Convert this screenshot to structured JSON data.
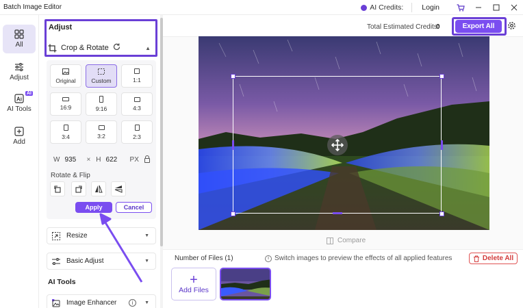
{
  "app": {
    "title": "Batch Image Editor"
  },
  "titlebar": {
    "ai_credits_label": "AI Credits:",
    "login_label": "Login",
    "icons": [
      "credit-icon",
      "cart-icon",
      "maximize-icon",
      "minimize-icon",
      "restore-icon",
      "close-icon"
    ]
  },
  "leftnav": {
    "items": [
      {
        "label": "All",
        "icon": "grid-icon",
        "active": true
      },
      {
        "label": "Adjust",
        "icon": "sliders-icon"
      },
      {
        "label": "AI Tools",
        "icon": "ai-icon",
        "badge": "AI"
      },
      {
        "label": "Add",
        "icon": "plus-square-icon"
      }
    ]
  },
  "adjust_panel": {
    "title": "Adjust",
    "crop_rotate_label": "Crop & Rotate",
    "ratios": [
      {
        "label": "Original",
        "icon": "image-icon"
      },
      {
        "label": "Custom",
        "icon": "custom-crop-icon",
        "selected": true
      },
      {
        "label": "1:1"
      },
      {
        "label": "16:9"
      },
      {
        "label": "9:16"
      },
      {
        "label": "4:3"
      },
      {
        "label": "3:4"
      },
      {
        "label": "3:2"
      },
      {
        "label": "2:3"
      }
    ],
    "dimensions": {
      "w_label": "W",
      "w_value": "935",
      "times": "×",
      "h_label": "H",
      "h_value": "622",
      "unit": "PX"
    },
    "rotate_flip_title": "Rotate & Flip",
    "apply_label": "Apply",
    "cancel_label": "Cancel",
    "resize_label": "Resize",
    "basic_adjust_label": "Basic Adjust",
    "ai_tools_title": "AI Tools",
    "image_enhancer_label": "Image Enhancer"
  },
  "header": {
    "total_credits_label": "Total Estimated Credits:",
    "total_credits_value": "0",
    "export_all_label": "Export All"
  },
  "preview": {
    "compare_label": "Compare"
  },
  "files": {
    "count_label": "Number of Files (1)",
    "switch_info": "Switch images to preview the effects of all applied features",
    "delete_all_label": "Delete All",
    "add_files_label": "Add Files"
  },
  "colors": {
    "accent": "#7a4df0",
    "highlight_box": "#6a3fd6",
    "danger": "#d23b3b"
  }
}
